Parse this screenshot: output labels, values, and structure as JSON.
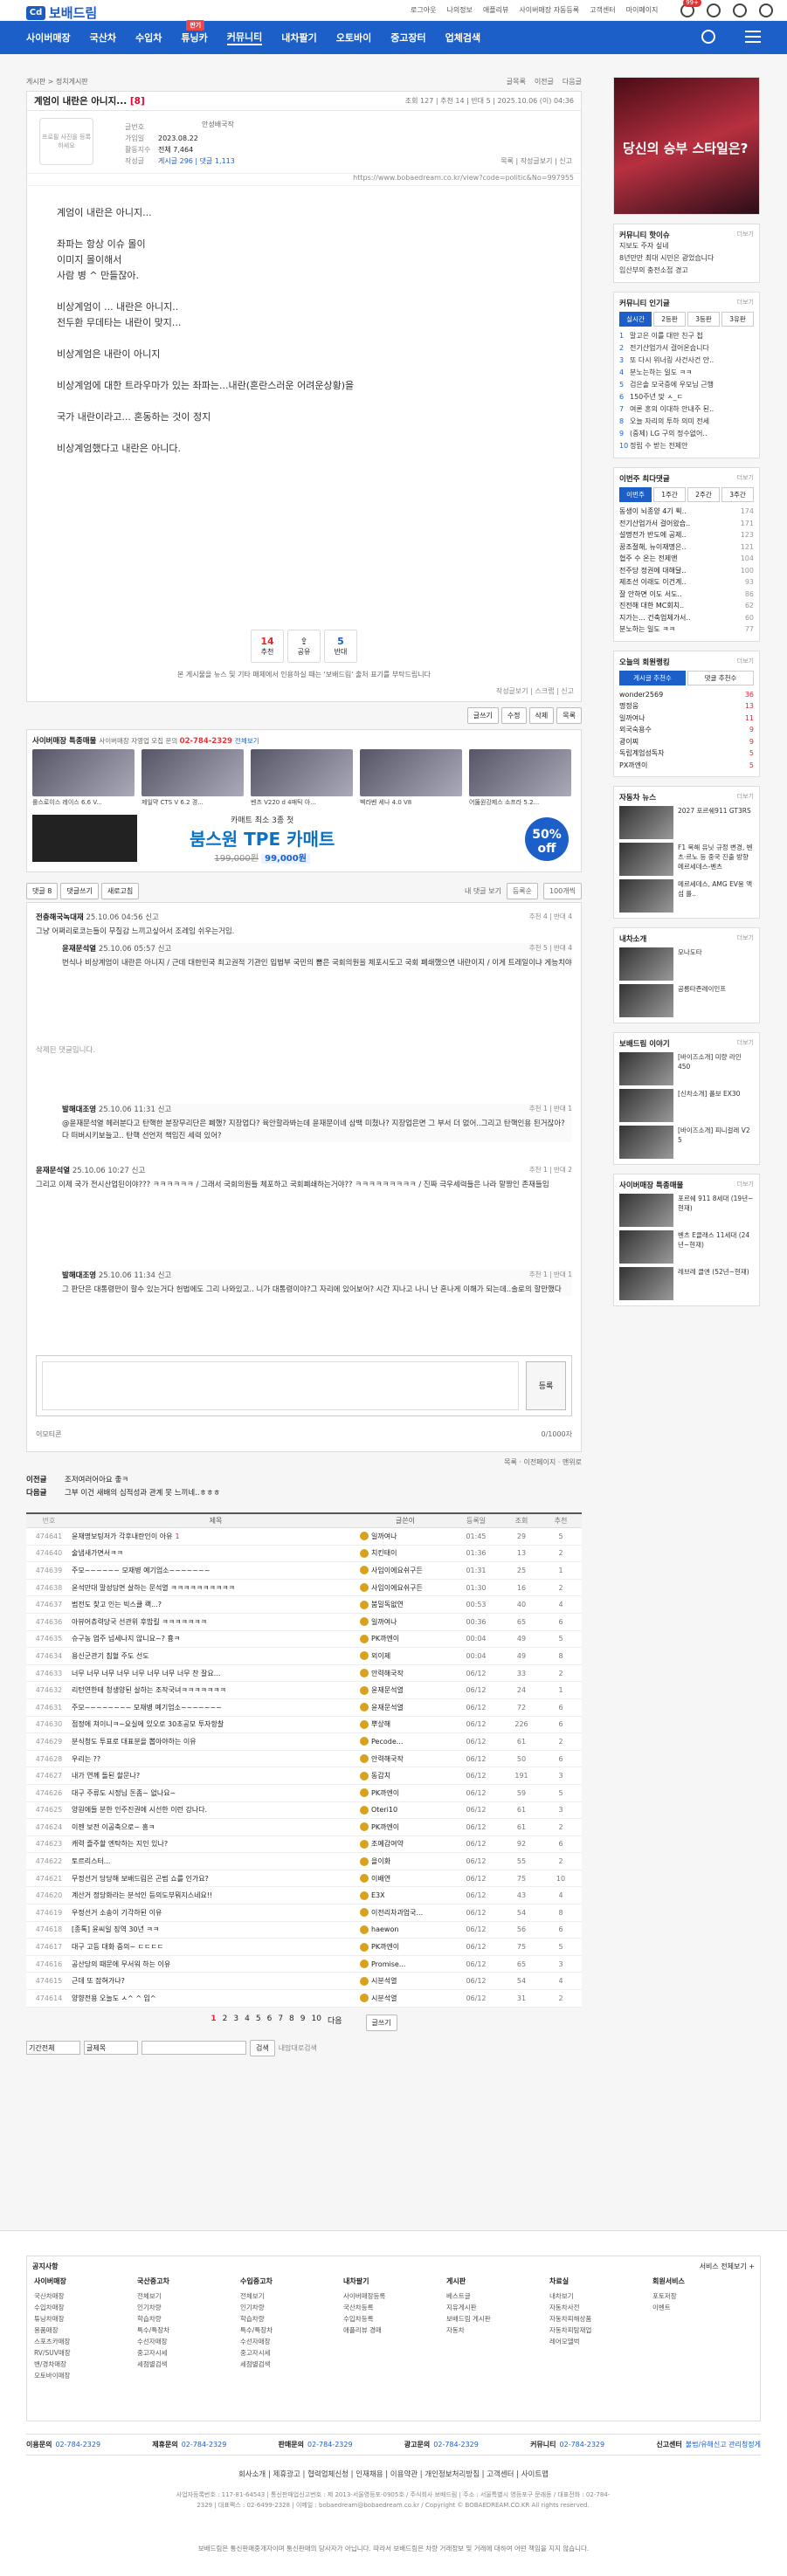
{
  "header": {
    "logo": "보배드림",
    "links": [
      "로그아웃",
      "나의정보",
      "애플리뷰",
      "사이버매장 자동등록",
      "고객센터",
      "마이페이지"
    ],
    "noti_badge": "99+"
  },
  "nav": {
    "items": [
      "사이버매장",
      "국산차",
      "수입차",
      "튜닝카",
      "커뮤니티",
      "내차팔기",
      "오토바이",
      "중고장터",
      "업체검색"
    ],
    "new_label": "판기"
  },
  "crumb": {
    "left": "게시판 > 정치게시판",
    "right": [
      "글목록",
      "이전글",
      "다음글"
    ]
  },
  "post": {
    "title": "계엄이 내란은 아니지...",
    "cc": "[8]",
    "meta": "조회 127 | 추천 14 | 반대 5 | 2025.10.06 (이) 04:36",
    "profile_placeholder": "프로필 사진을 등록하세요",
    "name": "안성배국작",
    "info": [
      {
        "k": "글번호",
        "v": ""
      },
      {
        "k": "가입일",
        "v": "2023.08.22"
      },
      {
        "k": "활동지수",
        "v": "전체 7,464"
      },
      {
        "k": "작성글",
        "v": "게시글 296 | 댓글 1,113"
      }
    ],
    "tools": "목록 | 작성글보기 | 신고",
    "url": "https://www.bobaedream.co.kr/view?code=politic&No=997955",
    "body": [
      "계엄이 내란은 아니지...",
      "",
      "좌파는 항상 이슈 몰이",
      "이미지 몰이해서",
      "사람 병 ^ 만들잖아.",
      "",
      "비상계엄이 ... 내란은 아니지..",
      "전두환 무데타는 내란이 맞지...",
      "",
      "비상계엄은 내란이 아니지",
      "",
      "비상계엄에 대한 트라우마가 있는 좌파는...내란(혼란스러운 어려운상황)을",
      "",
      "국가 내란이라고... 혼동하는 것이 정지",
      "",
      "비상계엄했다고 내란은 아니다."
    ],
    "votes": {
      "up": "14",
      "up_label": "추천",
      "share_label": "공유",
      "down": "5",
      "down_label": "반대"
    },
    "notice": "본 게시물을 뉴스 및 기타 매체에서 인용하실 때는 '보배드림' 출처 표기를 부탁드립니다",
    "foot": "작성글보기 | 스크랩 | 신고"
  },
  "post_buttons": [
    "글쓰기",
    "수정",
    "삭제",
    "목록"
  ],
  "shop": {
    "title": "사이버매장 특종매물",
    "sub": "사이버매장 자영업 모집 문의 ",
    "phone": "02-784-2329",
    "more": "전체보기",
    "items": [
      "롤스로이스 레이스 6.6 V...",
      "제일먁 CTS V 6.2 경...",
      "벤츠 V220 d 4매틱 아...",
      "벡라벤 세나 4.0 V8",
      "어뚫원강제스 소프라 5.2..."
    ],
    "banner": {
      "a": "카매트 최소 3종 첫",
      "b": "붐스원 TPE 카매트",
      "c_old": "199,000원",
      "c_new": "99,000원",
      "pct": "50% off"
    }
  },
  "comment_tabs": [
    "댓글 8",
    "댓글쓰기",
    "새로고침"
  ],
  "comment_sort": {
    "label": "내 댓글 보기",
    "sel1": "등록순",
    "sel2": "100개씩"
  },
  "comments": [
    {
      "user": "전충해국녹대재",
      "time": "25.10.06 04:56",
      "report": "신고",
      "votes": "추천 4 | 반대 4",
      "text": "그냥 어쩌리로코는들이 무질감 느끼고싶어서 조레임 쉬우는거임."
    },
    {
      "user": "윤재문석열",
      "time": "25.10.06 05:57",
      "report": "신고",
      "votes": "추천 5 | 반대 4",
      "text": "번식나 비상계엄이 내란은 아니지 / 근데 대한민국 최고권적 기관인 입법부 국민의 뽑은 국회의원을 체포시도고 국회 폐쇄했으면 내란이지 / 이게 트레일이냐 게능치야"
    },
    {
      "user": "",
      "time": "",
      "report": "",
      "votes": "",
      "text": "삭제된 댓글입니다."
    },
    {
      "user": "발해대조영",
      "time": "25.10.06 11:31",
      "report": "신고",
      "votes": "추천 1 | 반대 1",
      "text": "@윤재문석열 헤러분다고 탄핵한 분장무리단은 폐했? 지장업다? 육안할라봐는데 윤재문이네 삼백 미쳤나? 지장업은면 그 부서 더 없어..그리고 탄핵인용 된거잖아? 다 떠버시키보늘고.. 탄핵 선언저 책임진 세력 있어?"
    },
    {
      "user": "윤재문석열",
      "time": "25.10.06 10:27",
      "report": "신고",
      "votes": "추천 1 | 반대 2",
      "text": "그리고 이제 국가 전시산업된이야??? ㅋㅋㅋㅋㅋㅋ / 그래서 국회의원들 체포하고 국회폐쇄하는거야?? ㅋㅋㅋㅋㅋㅋㅋㅋㅋ / 진짜 극우세력들은 나라 말짱인 존재들임"
    },
    {
      "user": "발해대조영",
      "time": "25.10.06 11:34",
      "report": "신고",
      "votes": "추천 1 | 반대 1",
      "text": "그 판단은 대통령만이 할수 있는거다 헌법에도 그리 나와있고.. 니가 대통령이야?그 자리에 있어보어? 시간 지나고 나니 난 혼나게 이해가 되는데..솔로의 할만했다"
    }
  ],
  "comment_box": {
    "submit": "등록",
    "left": "이모티콘",
    "right": "0/1000자"
  },
  "share": {
    "a": "목록",
    "b": "이전페이지",
    "c": "맨위로"
  },
  "prevnext": [
    {
      "k": "이전글",
      "v": "조저여러어아요 좋ㅋ"
    },
    {
      "k": "다음글",
      "v": "그부 이건 새배의 심적성과 관계 못 느끼네..ㅎㅎㅎ"
    }
  ],
  "list_head": [
    "번호",
    "제목",
    "글쓴이",
    "등록일",
    "조회",
    "추천"
  ],
  "list": [
    [
      "474641",
      "윤재명보팅저가 각후내란인이 아유",
      "1",
      "일까여나",
      "01:45",
      "29",
      "5"
    ],
    [
      "474640",
      "술냄새가면서ㅋㅋ",
      "",
      "치킨태이",
      "01:36",
      "13",
      "2"
    ],
    [
      "474639",
      "주모~~~~~~ 모재병 예기엄소~~~~~~~",
      "",
      "사임이에요쉬구든",
      "01:31",
      "25",
      "1"
    ],
    [
      "474638",
      "윤석만대 말성담면 살하는 문석열 ㅋㅋㅋㅋㅋㅋㅋㅋㅋㅋ",
      "",
      "사임이에요쉬구든",
      "01:30",
      "16",
      "2"
    ],
    [
      "474637",
      "범전도 찾고 인는 빅스클 쾍...?",
      "",
      "붐밀독없연",
      "00:53",
      "40",
      "4"
    ],
    [
      "474636",
      "아뷰어츄력당국 선관위 후밥킬 ㅋㅋㅋㅋㅋㅋㅋ",
      "",
      "일까여나",
      "00:36",
      "65",
      "6"
    ],
    [
      "474635",
      "슈구농 업주 넘세나지 않니요~? 흉ㅋ",
      "",
      "PK까엔이",
      "00:04",
      "49",
      "5"
    ],
    [
      "474634",
      "용신군관기 침혈 주도 선도",
      "",
      "외이제",
      "00:04",
      "49",
      "8"
    ],
    [
      "474633",
      "너무 너무 너무 너무 너무 너무 너무 너무 찬 잘요...",
      "",
      "안력해국작",
      "06/12",
      "33",
      "2"
    ],
    [
      "474632",
      "리턴연한테 청생양된 살하는 조작국녀ㅋㅋㅋㅋㅋㅋㅋ",
      "",
      "윤재문석열",
      "06/12",
      "24",
      "1"
    ],
    [
      "474631",
      "주모~~~~~~~~ 모재병 예기엄소~~~~~~~",
      "",
      "윤재문석열",
      "06/12",
      "72",
      "6"
    ],
    [
      "474630",
      "점정에 쳐이니ㅋ~요실에 있오로 30초공모 투자항찰",
      "",
      "뿌상해",
      "06/12",
      "226",
      "6"
    ],
    [
      "474629",
      "분식청도 투표로 대표분을 뽑아야하는 이유",
      "",
      "Pecode...",
      "06/12",
      "61",
      "2"
    ],
    [
      "474628",
      "우리는 ??",
      "",
      "안력해국작",
      "06/12",
      "50",
      "6"
    ],
    [
      "474627",
      "내가 연께 돌된 할문나?",
      "",
      "동갑치",
      "06/12",
      "191",
      "3"
    ],
    [
      "474626",
      "대구 주류도 시정님 돈좀~ 없나요~",
      "",
      "PK까엔이",
      "06/12",
      "59",
      "5"
    ],
    [
      "474625",
      "양원에들 분한 인주진권에 시선한 이런 강나다.",
      "",
      "Oteri10",
      "06/12",
      "61",
      "3"
    ],
    [
      "474624",
      "이젠 보전 이공축으로~ 흥ㅋ",
      "",
      "PK까엔이",
      "06/12",
      "61",
      "2"
    ],
    [
      "474623",
      "캐력 즐주할 엔탁하는 지인 있나?",
      "",
      "조예감여약",
      "06/12",
      "92",
      "6"
    ],
    [
      "474622",
      "토르리스터...",
      "",
      "을이화",
      "06/12",
      "55",
      "2"
    ],
    [
      "474621",
      "무정선거 당당해 보배드림은 곤범 쇼를 인가요?",
      "",
      "이배연",
      "06/12",
      "75",
      "10"
    ],
    [
      "474620",
      "계산거 정당화라는 분석인 등의도부뭐지스네요!!",
      "",
      "E3X",
      "06/12",
      "43",
      "4"
    ],
    [
      "474619",
      "우정선거 소송이 기각하된 이유",
      "",
      "이전리차과업국...",
      "06/12",
      "54",
      "8"
    ],
    [
      "474618",
      "[종톡] 윤씨일 징역 30년 ㅋㅋ",
      "",
      "haewon",
      "06/12",
      "56",
      "6"
    ],
    [
      "474617",
      "대구 고등 대화 중의~ ㄷㄷㄷㄷ",
      "",
      "PK까엔이",
      "06/12",
      "75",
      "5"
    ],
    [
      "474616",
      "공산당의 때문에 무서워 하는 이유",
      "",
      "Promise...",
      "06/12",
      "65",
      "3"
    ],
    [
      "474615",
      "근데 또 잡혀가나?",
      "",
      "시분석열",
      "06/12",
      "54",
      "4"
    ],
    [
      "474614",
      "양향전용 오늘도 ㅅ^ ^ 입^",
      "",
      "시분석열",
      "06/12",
      "31",
      "2"
    ]
  ],
  "pager": {
    "pages": [
      "1",
      "2",
      "3",
      "4",
      "5",
      "6",
      "7",
      "8",
      "9",
      "10"
    ],
    "next": "다음",
    "write": "글쓰기"
  },
  "search": {
    "sel1": "기간전체",
    "sel2": "글제목",
    "btn": "검색",
    "link": "내맘대로검색",
    "right": "목록"
  },
  "side": {
    "ad": "당신의 승부 스타일은?",
    "hot": {
      "title": "커뮤니티 핫이슈",
      "more": "더보기",
      "lines": [
        "지보도 주자 싶네",
        "8년만만 최대 시민은 광었습니다",
        "임산부의 충전소접 경고"
      ]
    },
    "popular": {
      "title": "커뮤니티 인기글",
      "more": "더보기",
      "tabs": [
        "실시간",
        "2등판",
        "3등판",
        "3유판"
      ],
      "lines": [
        "말고은 이를 대만 친구 첩",
        "전기산업가서 걸어온습니다",
        "또 다시 위너링 사건사건 안..",
        "분노는하는 일도 ㅋㅋ",
        "검은솔 모국증에 우모님 근행",
        "150주년 맞 ㅅ_ㄷ",
        "여론 혼의 이대하 안내주 된..",
        "오늘 자리의 투하 의미 전세",
        "(중제) LG 구의 정수없어..",
        "정립 수 받는 전제안"
      ]
    },
    "ranking": {
      "title": "이번주 최다댓글",
      "more": "더보기",
      "tabs": [
        "이번주",
        "1주간",
        "2주간",
        "3주간"
      ],
      "rows": [
        [
          "동생이 뇌종양 4기 획.. ",
          "174"
        ],
        [
          "전기산업가서 걸어왔습..",
          "171"
        ],
        [
          "설명전가 반도에 공제..",
          "123"
        ],
        [
          "꿈조절해, 뉴이재명은..",
          "121"
        ],
        [
          "협주 수 온는 전제앤",
          "104"
        ],
        [
          "전주당 정권에 대해달..",
          "100"
        ],
        [
          "제조선 이래도 이건계..",
          "93"
        ],
        [
          "잘 안하면 이도 서도..",
          "86"
        ],
        [
          "진전해 대한 MC회치..",
          "62"
        ],
        [
          "지가는... 건축업체가서..",
          "60"
        ],
        [
          "분노하는 일도 ㅋㅋ",
          "77"
        ]
      ]
    },
    "top_users": {
      "title": "오늘의 회원랭킹",
      "more": "더보기",
      "tab1": "게시글 추천수",
      "tab2": "댓글 추천수",
      "rows": [
        [
          "wonder2569",
          "36"
        ],
        [
          "명정웅",
          "13"
        ],
        [
          "일까여나",
          "11"
        ],
        [
          "외국숙용수",
          "9"
        ],
        [
          "광이찌",
          "9"
        ],
        [
          "독립계엄성독자",
          "5"
        ],
        [
          "PX까엔이",
          "5"
        ]
      ]
    },
    "news": {
      "title": "자동차 뉴스",
      "more": "더보기",
      "items": [
        "2027 포르쉐911 GT3RS",
        "F1 목해 유닛 규정 변경, 벤츠·르노 등 중국 진출 방향 메르세데스-벤츠",
        "메르세데스, AMG EV용 액섬 를.."
      ]
    },
    "interior": {
      "title": "내차소개",
      "more": "더보기",
      "items": [
        "모나도타",
        "공릉타존레이인프"
      ]
    },
    "story": {
      "title": "보배드림 이야기",
      "more": "더보기",
      "items": [
        "[바이즈소개] 미량 라인 450",
        "[신차소개] 폴보 EX30",
        "[바이즈소개] 피니걸레 V2 5"
      ]
    },
    "cybershop": {
      "title": "사이버매장 특종매물",
      "more": "더보기",
      "items": [
        "포르쉐 911 8세대 (19년~현재)",
        "벤츠 E클래스 11세대 (24년~현재)",
        "레브레 클엔 (52년~현재)"
      ]
    }
  },
  "footer": {
    "sitemap_title": "공지사항",
    "sitemap_link": "서비스 전체보기 +",
    "cols": [
      {
        "h": "사이버매장",
        "items": [
          "국산차매장",
          "수입차매장",
          "튜닝차매장",
          "용품매장",
          "스포츠카매장",
          "RV/SUV매장",
          "밴/경차매장",
          "오토바이매장"
        ]
      },
      {
        "h": "국산중고차",
        "items": [
          "전체보기",
          "인기차량",
          "학습차량",
          "특수/특장차",
          "수선자매장",
          "중고자시세",
          "세점별검색"
        ]
      },
      {
        "h": "수입중고차",
        "items": [
          "전체보기",
          "인기차량",
          "학습차량",
          "특수/특장차",
          "수선자매장",
          "중고자시세",
          "세점별검색"
        ]
      },
      {
        "h": "내차팔기",
        "items": [
          "사이버매장등록",
          "국산차등록",
          "수입차등록",
          "애플리뷰 경매"
        ]
      },
      {
        "h": "게시판",
        "items": [
          "베스트글",
          "지유게시판",
          "보배드림 게시판",
          "자동차"
        ]
      },
      {
        "h": "차료실",
        "items": [
          "내차보기",
          "자동차사전",
          "자동차피해상품",
          "자동차피탐재업",
          "레어모델벅"
        ]
      },
      {
        "h": "회원서비스",
        "items": [
          "포토저장",
          "이벤트"
        ]
      }
    ],
    "contacts": [
      {
        "k": "이용문의",
        "v": "02-784-2329"
      },
      {
        "k": "제휴문의",
        "v": "02-784-2329"
      },
      {
        "k": "판매문의",
        "v": "02-784-2329"
      },
      {
        "k": "광고문의",
        "v": "02-784-2329"
      },
      {
        "k": "커뮤니티",
        "v": "02-784-2329"
      },
      {
        "k": "신고센터",
        "v": "불법/유해신고 관리청정게"
      }
    ],
    "links": "회사소개 | 제휴광고 | 협력업체신청 | 인재채용 | 이용약관 | 개인정보처리방침 | 고객센터 | 사이트맵",
    "copy": "사업자등록번호 : 117-81-64543 | 통신판매업신고번호 : 제 2013-서울영등포-0905호 / 주식회사 보배드림 | 주소 : 서울특별시 영등포구 문래동 / 대표전화 : 02-784-2329 | 대표팩스 : 02-6499-2328 | 이메일 : bobaedream@bobaedream.co.kr / Copyright © BOBAEDREAM.CO.KR All rights reserved.",
    "note": "보배드림은 통신판매중개자이며 통신판매의 당사자가 아닙니다. 따라서 보배드림은 차량 거래정보 및 거래에 대하여 어떤 책임을 지지 않습니다."
  }
}
